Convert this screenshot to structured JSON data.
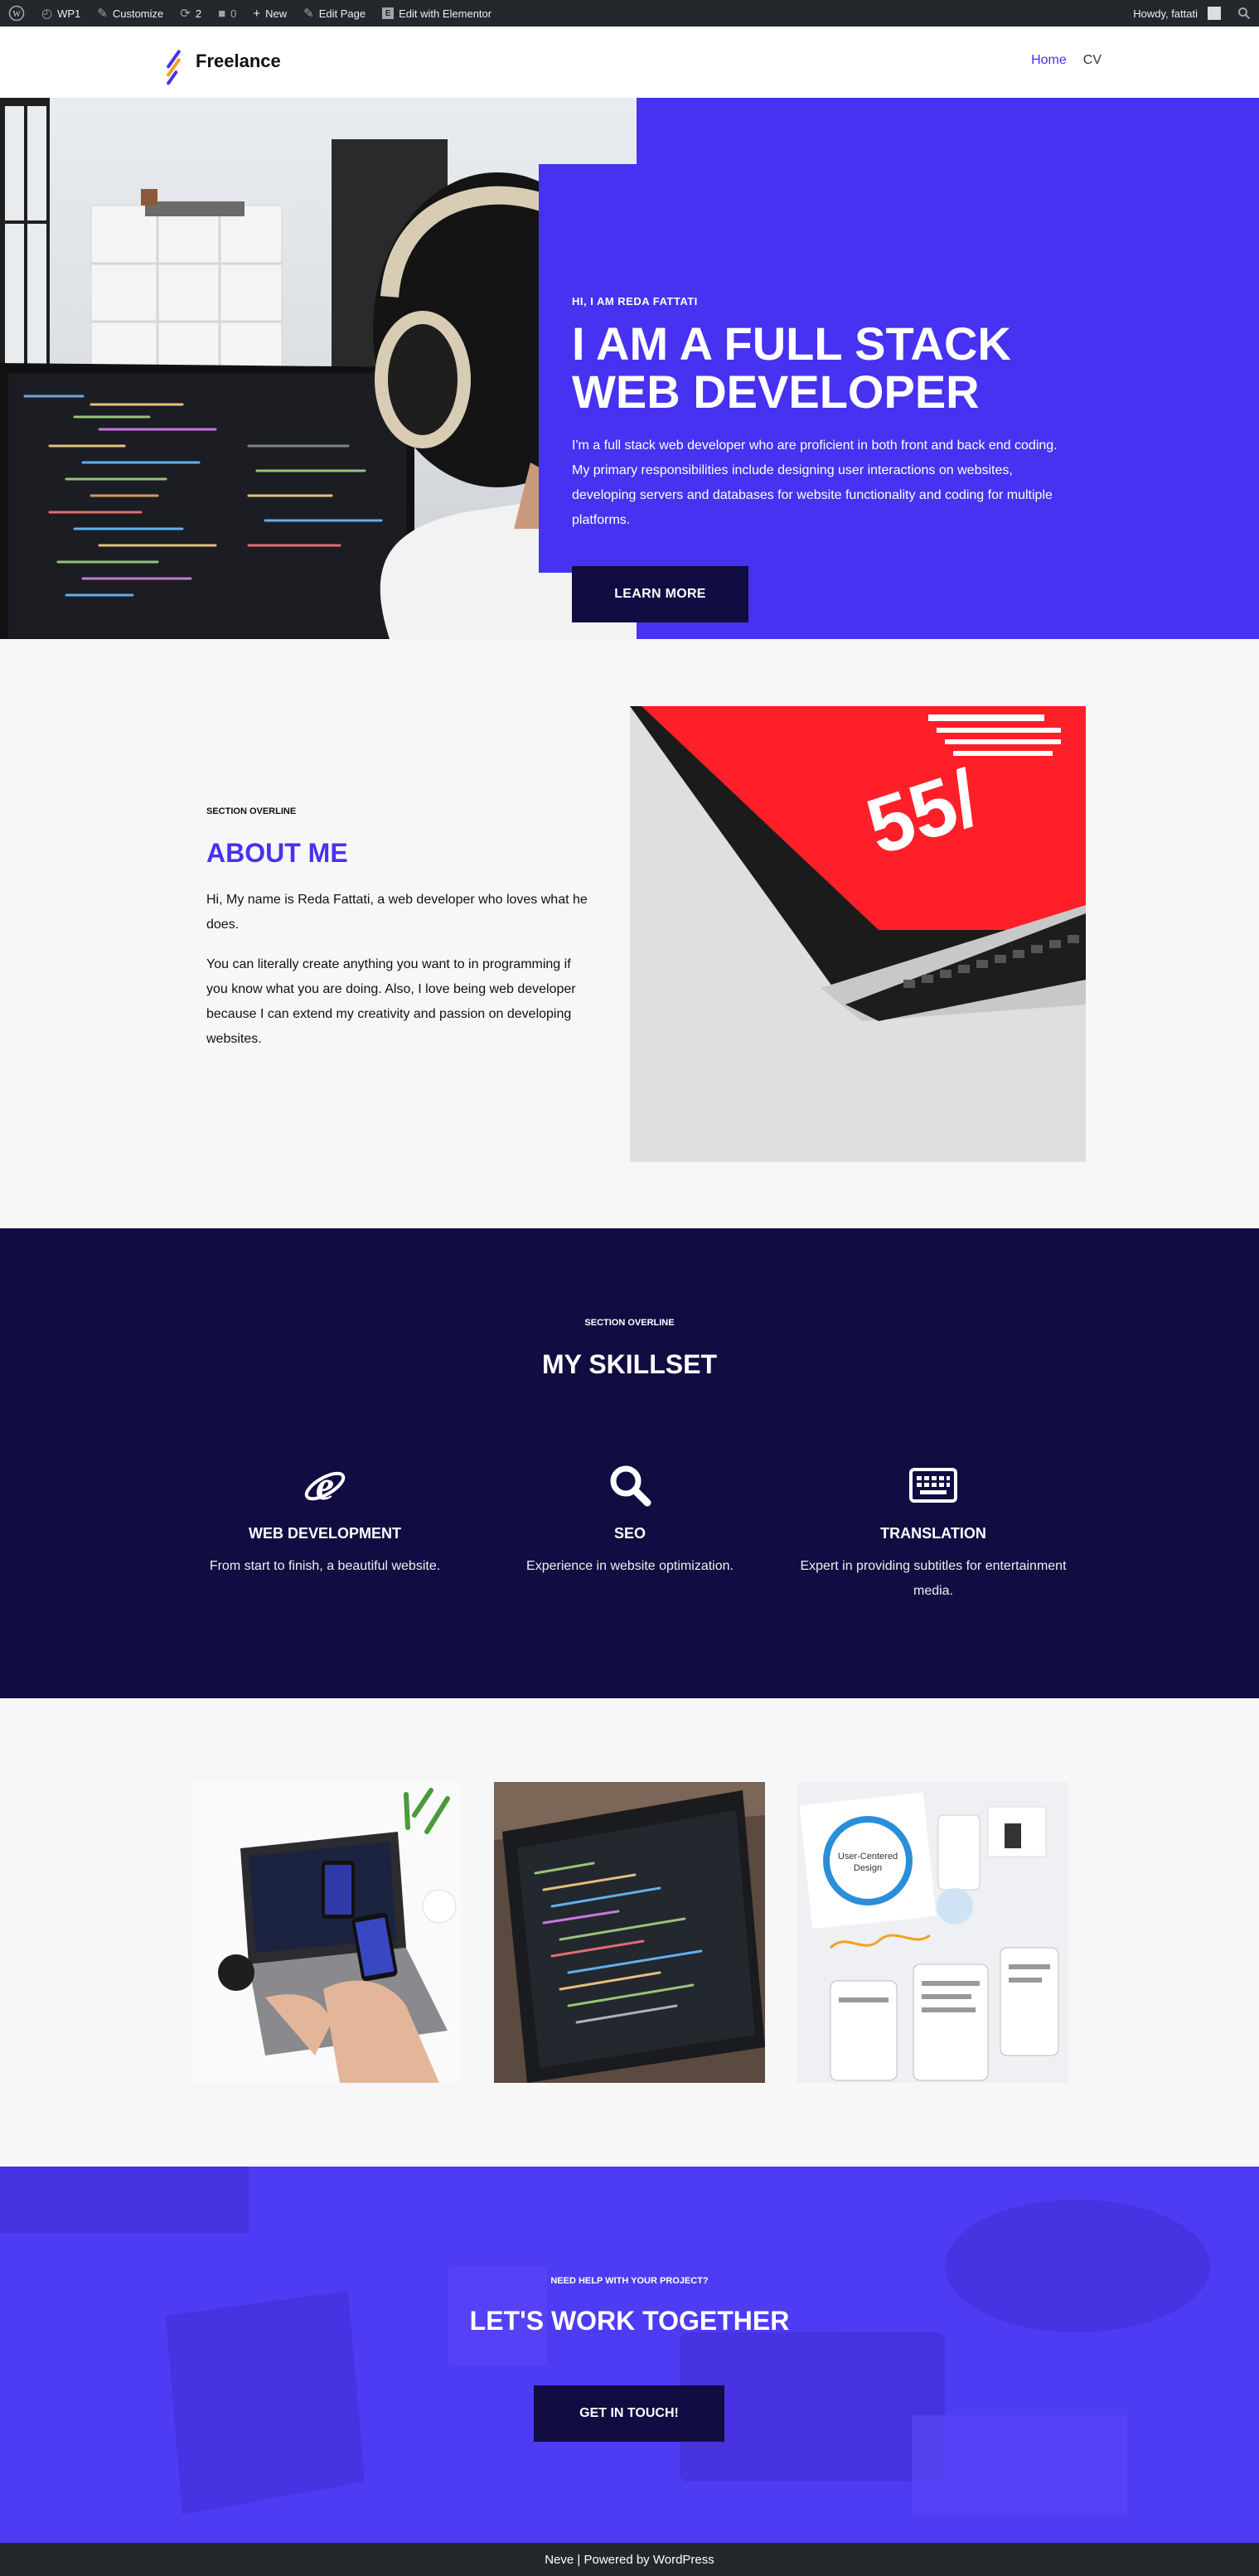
{
  "admin_bar": {
    "site_name": "WP1",
    "customize": "Customize",
    "updates_count": "2",
    "comments_count": "0",
    "new": "New",
    "edit_page": "Edit Page",
    "edit_elementor": "Edit with Elementor",
    "howdy": "Howdy, fattati"
  },
  "header": {
    "logo_text": "Freelance",
    "nav": [
      "Home",
      "CV"
    ]
  },
  "hero": {
    "kicker": "HI, I AM REDA FATTATI",
    "title": "I AM A FULL STACK WEB DEVELOPER",
    "description": "I'm a full stack web developer who are proficient in both front and back end coding. My primary responsibilities include designing user interactions on websites, developing servers and databases for website functionality and coding for multiple platforms.",
    "button": "LEARN MORE"
  },
  "about": {
    "kicker": "SECTION OVERLINE",
    "title": "ABOUT ME",
    "p1": "Hi, My name is Reda Fattati, a web developer who loves what he does.",
    "p2": "You can literally create anything you want to in programming if you know what you are doing. Also, I love being web developer because I can extend my creativity and passion on developing websites.",
    "image_text": "55/"
  },
  "skills": {
    "kicker": "SECTION OVERLINE",
    "title": "MY SKILLSET",
    "items": [
      {
        "icon": "internet-explorer-icon",
        "title": "WEB DEVELOPMENT",
        "text": "From start to finish, a beautiful website."
      },
      {
        "icon": "search-icon",
        "title": "SEO",
        "text": "Experience in website optimization."
      },
      {
        "icon": "keyboard-icon",
        "title": "TRANSLATION",
        "text": "Expert in providing subtitles for entertainment media."
      }
    ]
  },
  "gallery": {
    "image3_text": "User-Centered Design"
  },
  "cta": {
    "kicker": "NEED HELP WITH YOUR PROJECT?",
    "title": "LET'S WORK TOGETHER",
    "button": "GET IN TOUCH!"
  },
  "footer": {
    "text": "Neve | Powered by WordPress"
  },
  "colors": {
    "primary": "#4632f0",
    "dark": "#110c42",
    "admin_bar": "#23282d"
  }
}
